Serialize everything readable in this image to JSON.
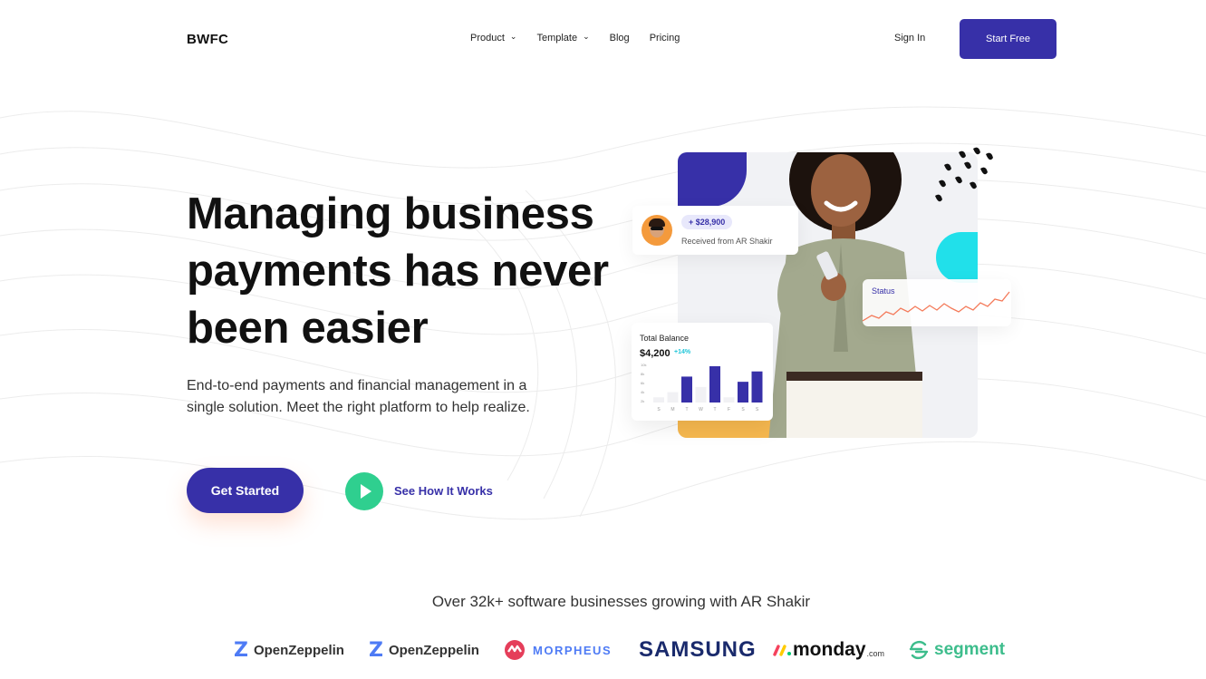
{
  "nav": {
    "logo": "BWFC",
    "links": [
      {
        "label": "Product",
        "has_dropdown": true
      },
      {
        "label": "Template",
        "has_dropdown": true
      },
      {
        "label": "Blog",
        "has_dropdown": false
      },
      {
        "label": "Pricing",
        "has_dropdown": false
      }
    ],
    "sign_in": "Sign In",
    "start_free": "Start Free"
  },
  "hero": {
    "title": "Managing business payments has never been easier",
    "subtitle": "End-to-end payments and financial management in a single solution. Meet the right platform to help realize.",
    "cta_primary": "Get Started",
    "cta_secondary": "See How It Works"
  },
  "cards": {
    "received": {
      "amount": "+ $28,900",
      "text": "Received from AR Shakir"
    },
    "status": {
      "label": "Status"
    },
    "balance": {
      "label": "Total Balance",
      "value": "$4,200",
      "change": "+14%",
      "days": [
        "S",
        "M",
        "T",
        "W",
        "T",
        "F",
        "S",
        "S"
      ],
      "y_ticks": [
        "10k",
        "8k",
        "6k",
        "4k",
        "2k"
      ]
    }
  },
  "chart_data": {
    "type": "bar",
    "categories": [
      "S",
      "M",
      "T",
      "W",
      "T",
      "F",
      "S",
      "S"
    ],
    "series": [
      {
        "values": [
          1,
          2,
          5,
          3,
          7,
          1,
          4,
          6
        ]
      }
    ]
  },
  "logos": {
    "title": "Over 32k+ software businesses growing with AR Shakir",
    "items": [
      "OpenZeppelin",
      "OpenZeppelin",
      "MORPHEUS",
      "SAMSUNG",
      "monday",
      "segment"
    ],
    "monday_suffix": ".com"
  },
  "colors": {
    "primary": "#3730a8",
    "play": "#2fcf8f",
    "cyan": "#21e0ea",
    "orange": "#f6b84f"
  }
}
